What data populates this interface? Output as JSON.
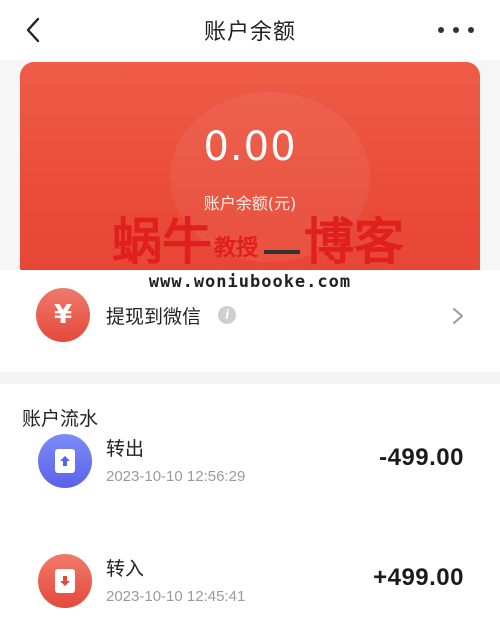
{
  "header": {
    "title": "账户余额"
  },
  "balance": {
    "amount": "0.00",
    "label": "账户余额(元)"
  },
  "watermark": {
    "part1": "蜗牛",
    "part2": "教授",
    "part3": "博客",
    "url": "www.woniubooke.com"
  },
  "withdraw": {
    "icon_glyph": "¥",
    "label": "提现到微信",
    "info_glyph": "i"
  },
  "flow": {
    "title": "账户流水",
    "items": [
      {
        "name": "转出",
        "time": "2023-10-10 12:56:29",
        "amount": "-499.00",
        "icon": "transfer-out-icon"
      },
      {
        "name": "转入",
        "time": "2023-10-10 12:45:41",
        "amount": "+499.00",
        "icon": "transfer-in-icon"
      }
    ]
  },
  "colors": {
    "card_red": "#e94c39",
    "transfer_out_blue": "#5a62e8",
    "transfer_in_red": "#e5483b"
  }
}
